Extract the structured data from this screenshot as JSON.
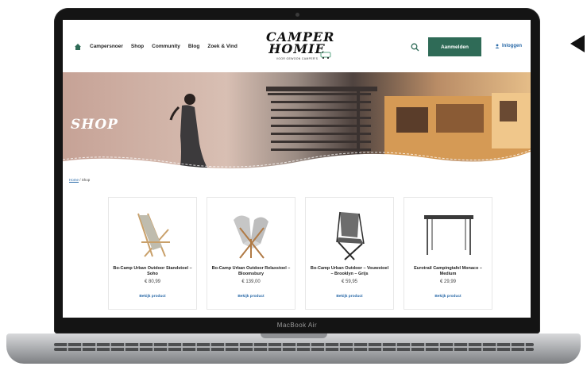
{
  "device": {
    "label": "MacBook Air"
  },
  "header": {
    "nav": [
      "Campersnoer",
      "Shop",
      "Community",
      "Blog",
      "Zoek & Vind"
    ],
    "logo_line1": "CAMPER",
    "logo_line2": "HOMIE",
    "logo_tagline": "VOOR GEWOON CAMPER'S",
    "login_label": "Aanmelden",
    "register_label": "Inloggen"
  },
  "hero": {
    "title": "SHOP"
  },
  "breadcrumb": {
    "home": "Home",
    "separator": " / ",
    "current": "Shop"
  },
  "products": [
    {
      "name": "Bo-Camp Urban Outdoor Standstoel – Soho",
      "price": "€ 80,99",
      "link": "Bekijk product"
    },
    {
      "name": "Bo-Camp Urban Outdoor Relaxstoel – Bloomsbury",
      "price": "€ 139,00",
      "link": "Bekijk product"
    },
    {
      "name": "Bo-Camp Urban Outdoor – Vouwstoel – Brooklyn – Grijs",
      "price": "€ 59,95",
      "link": "Bekijk product"
    },
    {
      "name": "Eurotrail Campingtafel Monaco – Medium",
      "price": "€ 29,99",
      "link": "Bekijk product"
    }
  ],
  "colors": {
    "primary_green": "#2f6b57",
    "link_blue": "#2a6aa8",
    "hero_warm": "#d9b9ae"
  }
}
